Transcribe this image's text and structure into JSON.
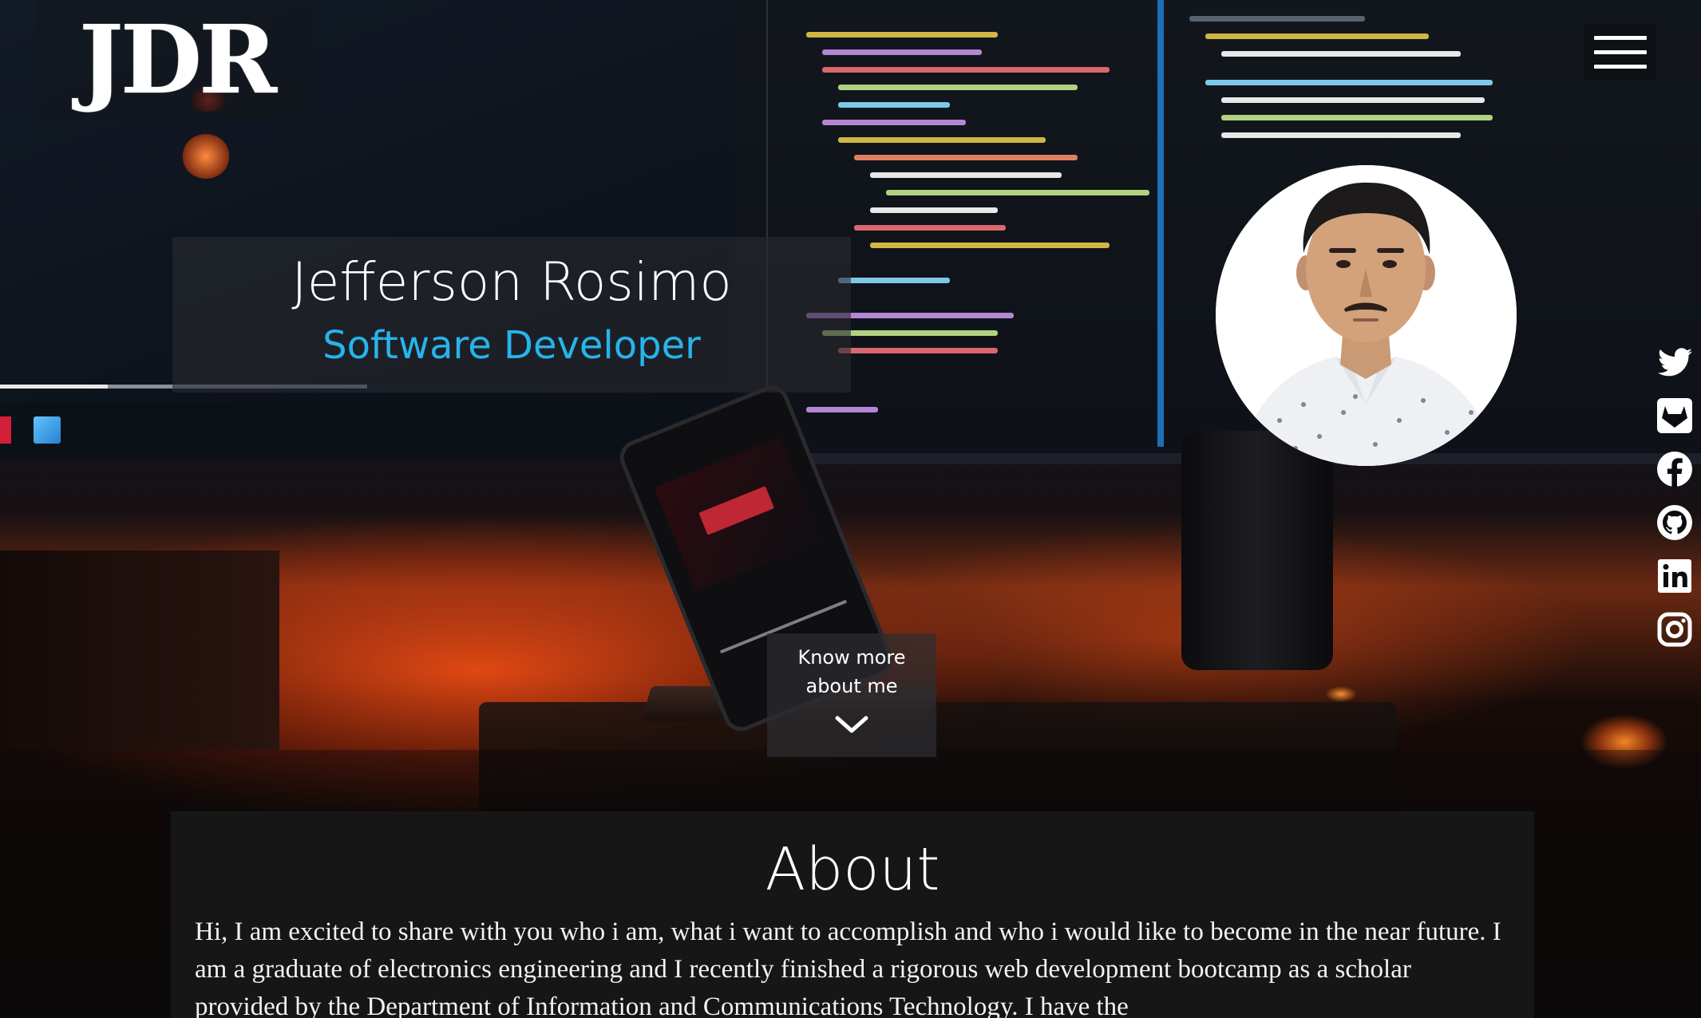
{
  "brand": {
    "logo_text": "JDR"
  },
  "nav": {
    "menu_icon": "hamburger-menu-icon"
  },
  "hero": {
    "name": "Jefferson Rosimo",
    "role": "Software Developer",
    "avatar_icon": "profile-photo"
  },
  "social": {
    "items": [
      {
        "network": "twitter",
        "icon": "twitter-icon"
      },
      {
        "network": "gitlab",
        "icon": "gitlab-icon"
      },
      {
        "network": "facebook",
        "icon": "facebook-icon"
      },
      {
        "network": "github",
        "icon": "github-icon"
      },
      {
        "network": "linkedin",
        "icon": "linkedin-icon"
      },
      {
        "network": "instagram",
        "icon": "instagram-icon"
      }
    ]
  },
  "cta": {
    "know_more_line1": "Know more",
    "know_more_line2": "about me",
    "icon": "chevron-down-icon"
  },
  "about": {
    "title": "About",
    "text": "Hi, I am excited to share with you who i am, what i want to accomplish and who i would like to become in the near future. I am a graduate of electronics engineering and I recently finished a rigorous web development bootcamp as a scholar provided by the Department of Information and Communications Technology. I have the"
  },
  "colors": {
    "accent": "#27b4ea",
    "panel_dark": "#161616",
    "text_primary": "#ffffff"
  }
}
